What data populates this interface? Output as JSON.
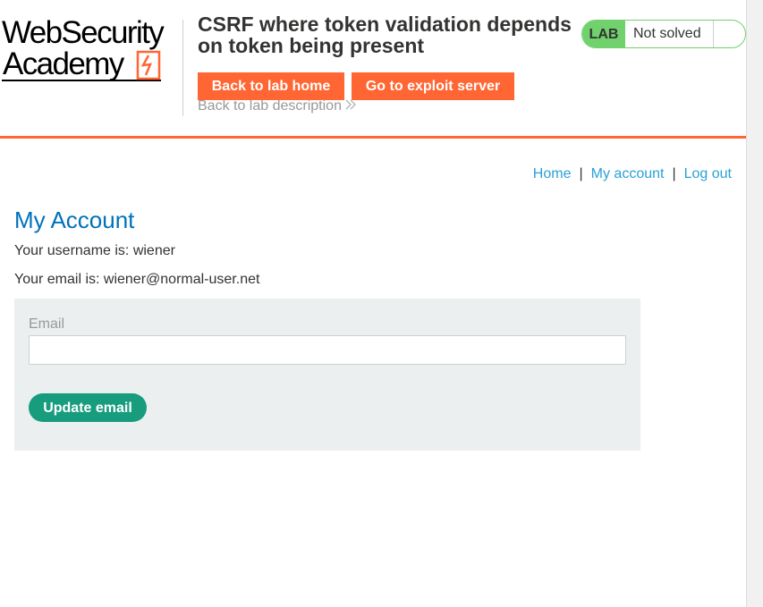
{
  "logo": {
    "line1": "WebSecurity",
    "line2": "Academy"
  },
  "header": {
    "lab_title": "CSRF where token validation depends on token being present",
    "back_to_lab_home": "Back to lab home",
    "go_to_exploit_server": "Go to exploit server",
    "back_to_description": "Back to lab description",
    "back_to_description_icon": "chevron-double-right-icon"
  },
  "status": {
    "badge": "LAB",
    "text": "Not solved",
    "icon": "flask-icon"
  },
  "nav": {
    "home": "Home",
    "my_account": "My account",
    "log_out": "Log out",
    "separator": "|"
  },
  "account": {
    "heading": "My Account",
    "username_line": "Your username is: wiener",
    "email_line": "Your email is: wiener@normal-user.net"
  },
  "form": {
    "email_label": "Email",
    "email_value": "",
    "email_placeholder": "",
    "submit_label": "Update email"
  },
  "colors": {
    "accent_orange": "#ff6633",
    "link_blue": "#29a1d6",
    "heading_blue": "#0071bc",
    "status_green": "#70d16d",
    "button_green": "#179c7e",
    "form_bg": "#ebeff0"
  }
}
